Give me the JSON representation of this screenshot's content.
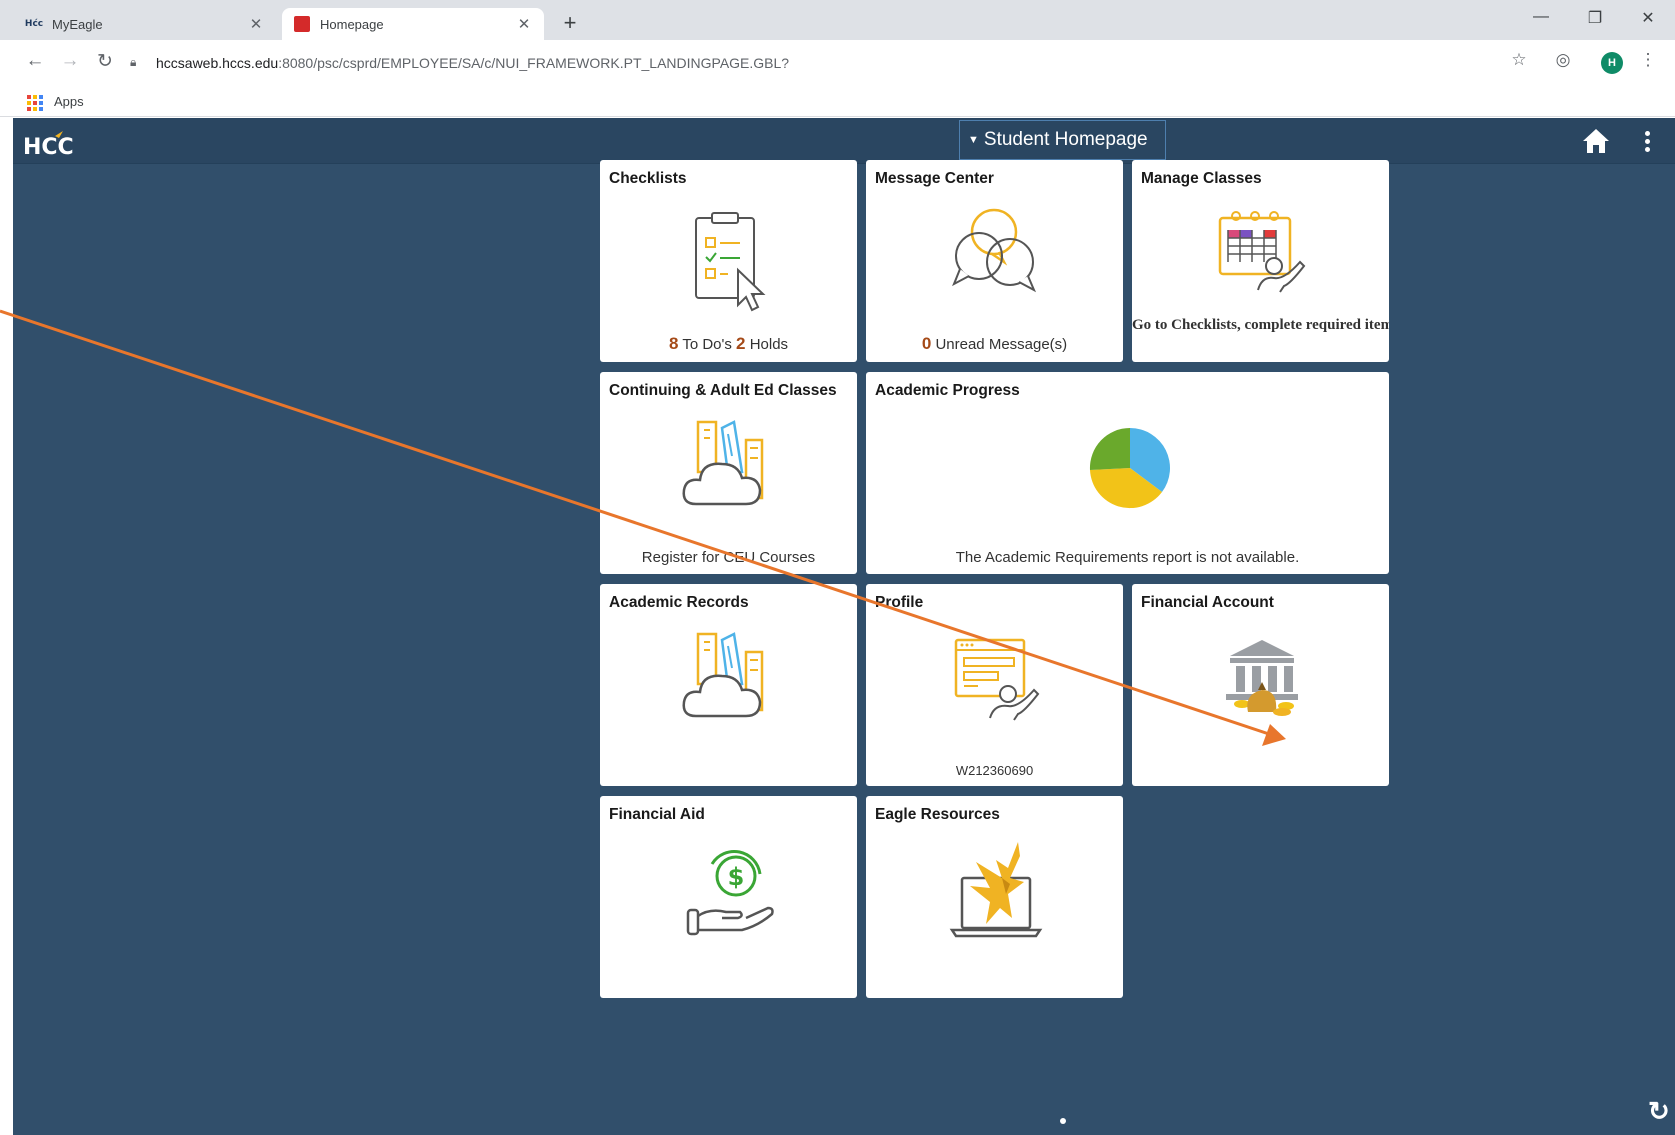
{
  "browser": {
    "tabs": [
      {
        "label": "MyEagle",
        "favicon": "hcc-favicon",
        "active": false
      },
      {
        "label": "Homepage",
        "favicon": "red-favicon",
        "active": true
      }
    ],
    "url_host": "hccsaweb.hccs.edu",
    "url_path": ":8080/psc/csprd/EMPLOYEE/SA/c/NUI_FRAMEWORK.PT_LANDINGPAGE.GBL?",
    "bookmarks": [
      {
        "label": "Apps"
      }
    ],
    "profile_initial": "H",
    "profile_color": "#0f8b67"
  },
  "banner": {
    "logo_text": "HCC",
    "page_selector": "Student Homepage",
    "background": "#2a4661"
  },
  "tiles": {
    "checklists": {
      "title": "Checklists",
      "todo_count": "8",
      "todo_label": "To Do's",
      "holds_count": "2",
      "holds_label": "Holds"
    },
    "message_center": {
      "title": "Message Center",
      "unread_count": "0",
      "unread_label": "Unread Message(s)"
    },
    "manage_classes": {
      "title": "Manage Classes",
      "warning": "Go to Checklists, complete required items."
    },
    "continuing_ed": {
      "title": "Continuing & Adult Ed Classes",
      "footer": "Register for CEU Courses"
    },
    "academic_progress": {
      "title": "Academic Progress",
      "footer": "The Academic Requirements report is not available.",
      "pie_colors": [
        "#4fb3e8",
        "#f2c318",
        "#6aa92c"
      ]
    },
    "academic_records": {
      "title": "Academic Records"
    },
    "profile": {
      "title": "Profile",
      "footer": "W212360690"
    },
    "financial_account": {
      "title": "Financial Account"
    },
    "financial_aid": {
      "title": "Financial Aid"
    },
    "eagle_resources": {
      "title": "Eagle Resources"
    }
  },
  "annotation": {
    "color": "#e8762c",
    "target": "financial-account-icon"
  }
}
